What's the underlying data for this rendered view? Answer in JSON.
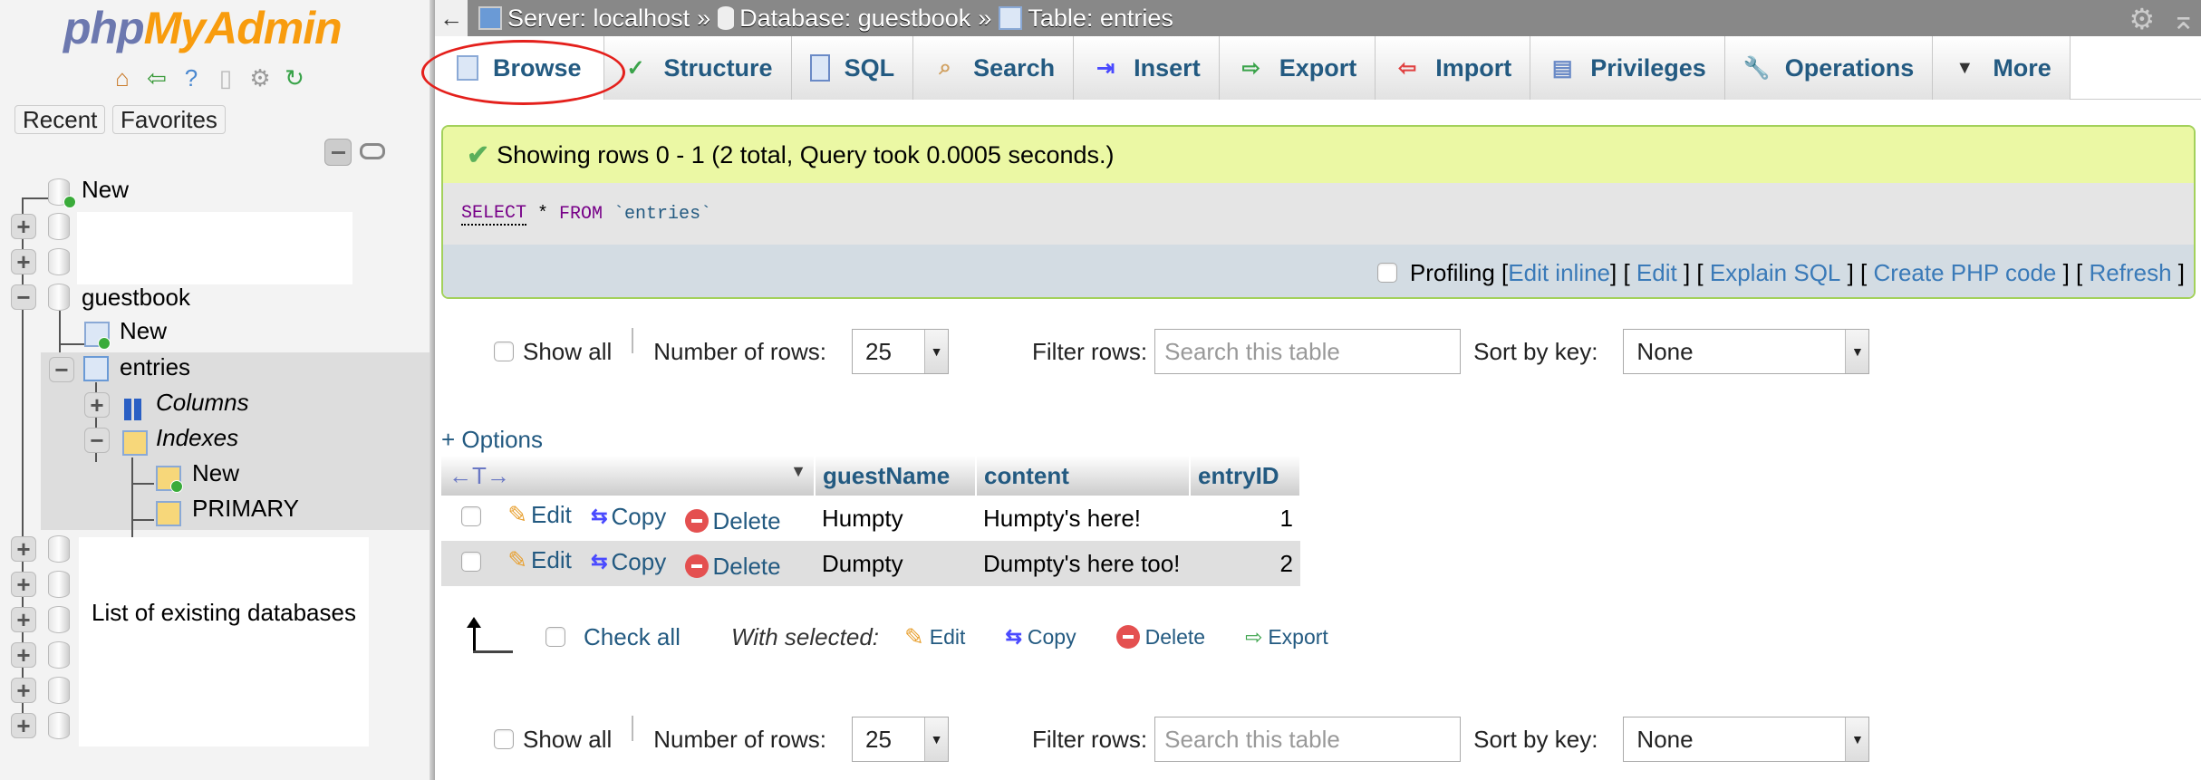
{
  "sidebar": {
    "logo": {
      "part1": "php",
      "part2": "MyAdmin"
    },
    "quick_icons": [
      "home-icon",
      "logout-icon",
      "help-icon",
      "docs-icon",
      "settings-icon",
      "reload-icon"
    ],
    "buttons": {
      "recent": "Recent",
      "favorites": "Favorites"
    },
    "tree": {
      "new_db": "New",
      "guestbook": "guestbook",
      "new_table": "New",
      "entries": "entries",
      "columns": "Columns",
      "indexes": "Indexes",
      "new_index": "New",
      "primary": "PRIMARY"
    },
    "annotation": "List of existing databases"
  },
  "topbar": {
    "back": "←",
    "breadcrumb": [
      {
        "label": "Server: localhost",
        "icon": "server-icon"
      },
      {
        "label": "Database: guestbook",
        "icon": "database-icon"
      },
      {
        "label": "Table: entries",
        "icon": "table-icon"
      }
    ],
    "separator": "»"
  },
  "tabs": [
    {
      "label": "Browse",
      "icon": "browse-icon",
      "active": true
    },
    {
      "label": "Structure",
      "icon": "structure-icon"
    },
    {
      "label": "SQL",
      "icon": "sql-icon"
    },
    {
      "label": "Search",
      "icon": "search-icon"
    },
    {
      "label": "Insert",
      "icon": "insert-icon"
    },
    {
      "label": "Export",
      "icon": "export-icon"
    },
    {
      "label": "Import",
      "icon": "import-icon"
    },
    {
      "label": "Privileges",
      "icon": "privileges-icon"
    },
    {
      "label": "Operations",
      "icon": "operations-icon"
    },
    {
      "label": "More",
      "icon": "caret-down-icon"
    }
  ],
  "result": {
    "message": "Showing rows 0 - 1 (2 total, Query took 0.0005 seconds.)",
    "sql": {
      "select": "SELECT",
      "star": " * ",
      "from": "FROM",
      "table": " `entries`"
    },
    "profiling": "Profiling",
    "links": [
      "Edit inline",
      "Edit",
      "Explain SQL",
      "Create PHP code",
      "Refresh"
    ]
  },
  "navigation": {
    "show_all": "Show all",
    "num_rows_label": "Number of rows:",
    "num_rows_value": "25",
    "filter_label": "Filter rows:",
    "filter_placeholder": "Search this table",
    "sort_label": "Sort by key:",
    "sort_value": "None"
  },
  "options_link": "+ Options",
  "table": {
    "columns": [
      "guestName",
      "content",
      "entryID"
    ],
    "actions": {
      "edit": "Edit",
      "copy": "Copy",
      "delete": "Delete"
    },
    "rows": [
      {
        "guestName": "Humpty",
        "content": "Humpty's here!",
        "entryID": "1"
      },
      {
        "guestName": "Dumpty",
        "content": "Dumpty's here too!",
        "entryID": "2"
      }
    ]
  },
  "bulk": {
    "check_all": "Check all",
    "with_selected": "With selected:",
    "edit": "Edit",
    "copy": "Copy",
    "delete": "Delete",
    "export": "Export"
  },
  "colors": {
    "brand_blue": "#235a81",
    "success_bg": "#ebf8a4",
    "annotation_red": "#e4201c"
  }
}
